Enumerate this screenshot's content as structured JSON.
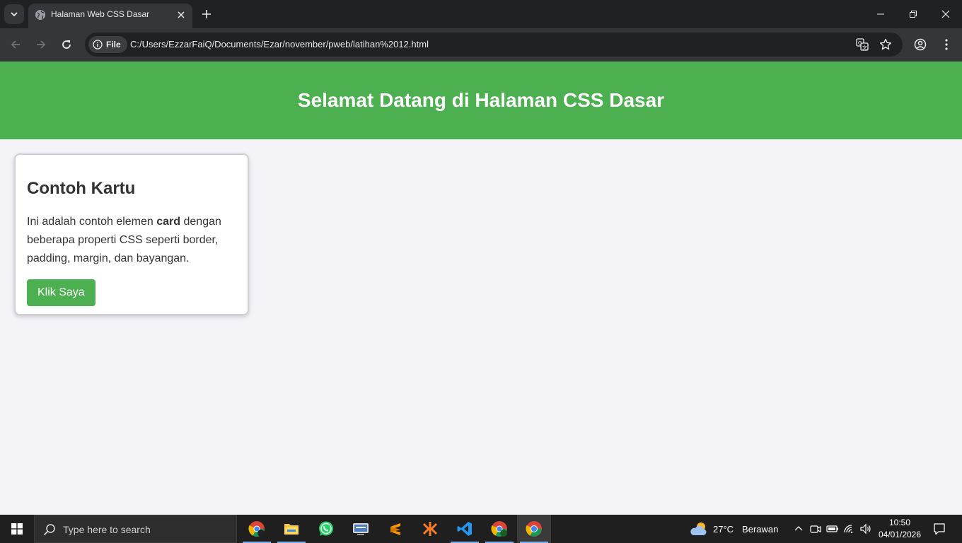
{
  "browser": {
    "tab_title": "Halaman Web CSS Dasar",
    "url_chip_label": "File",
    "url": "C:/Users/EzzarFaiQ/Documents/Ezar/november/pweb/latihan%2012.html"
  },
  "page": {
    "header_title": "Selamat Datang di Halaman CSS Dasar",
    "card": {
      "title": "Contoh Kartu",
      "text_before": "Ini adalah contoh elemen ",
      "text_bold": "card",
      "text_after": " dengan beberapa properti CSS seperti border, padding, margin, dan bayangan.",
      "button_label": "Klik Saya"
    }
  },
  "colors": {
    "accent_green": "#4caf50",
    "page_background": "#f3f3f8",
    "browser_dark": "#202124"
  },
  "taskbar": {
    "search_placeholder": "Type here to search",
    "apps": [
      "chrome-profile-icon",
      "file-explorer-icon",
      "whatsapp-icon",
      "network-app-icon",
      "sublime-text-icon",
      "xampp-icon",
      "vscode-icon",
      "chrome-profile-2-icon",
      "chrome-icon"
    ],
    "weather_temp": "27°C",
    "weather_desc": "Berawan",
    "time": "10:50",
    "date": "04/01/2026"
  }
}
